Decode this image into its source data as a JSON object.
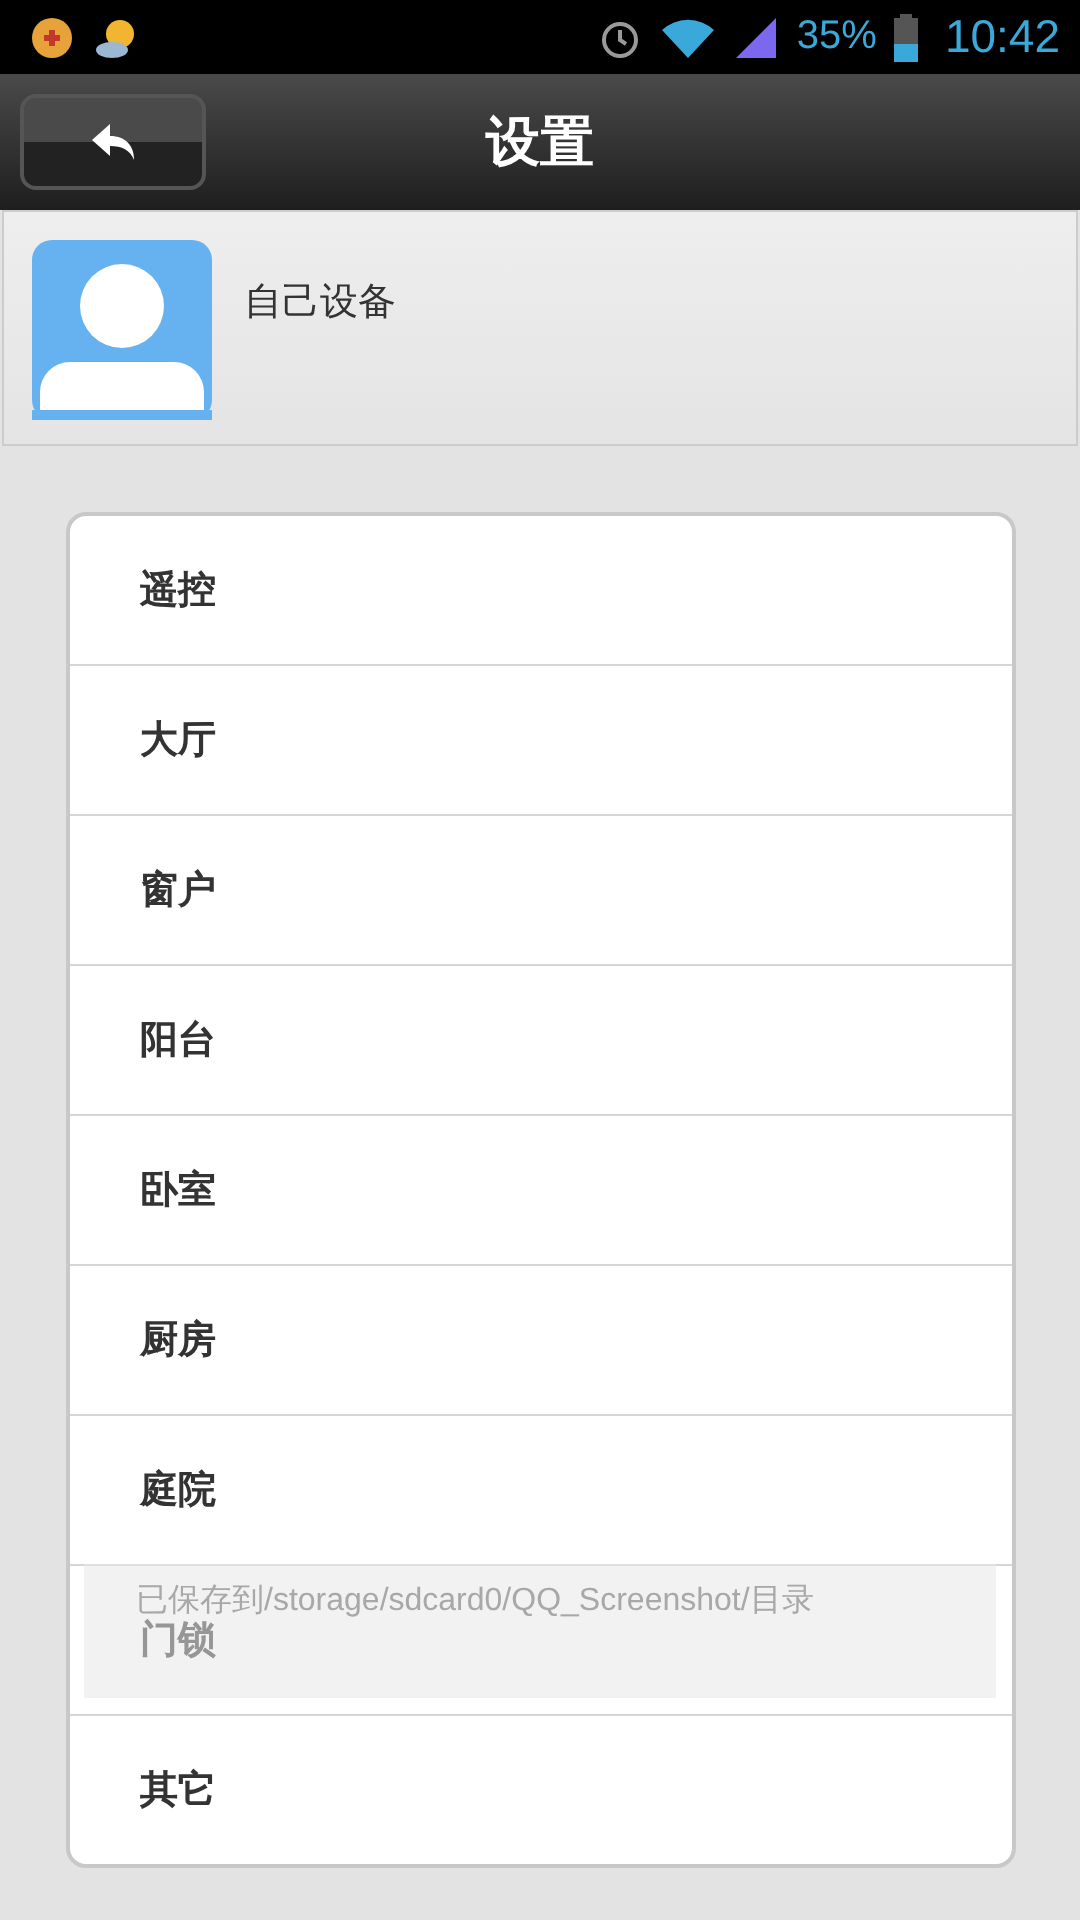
{
  "status_bar": {
    "battery": "35%",
    "time": "10:42"
  },
  "header": {
    "title": "设置"
  },
  "profile": {
    "name": "自己设备"
  },
  "rooms": [
    {
      "label": "遥控"
    },
    {
      "label": "大厅"
    },
    {
      "label": "窗户"
    },
    {
      "label": "阳台"
    },
    {
      "label": "卧室"
    },
    {
      "label": "厨房"
    },
    {
      "label": "庭院"
    },
    {
      "label": "门锁"
    },
    {
      "label": "其它"
    }
  ],
  "toast": {
    "text": "已保存到/storage/sdcard0/QQ_Screenshot/目录"
  }
}
